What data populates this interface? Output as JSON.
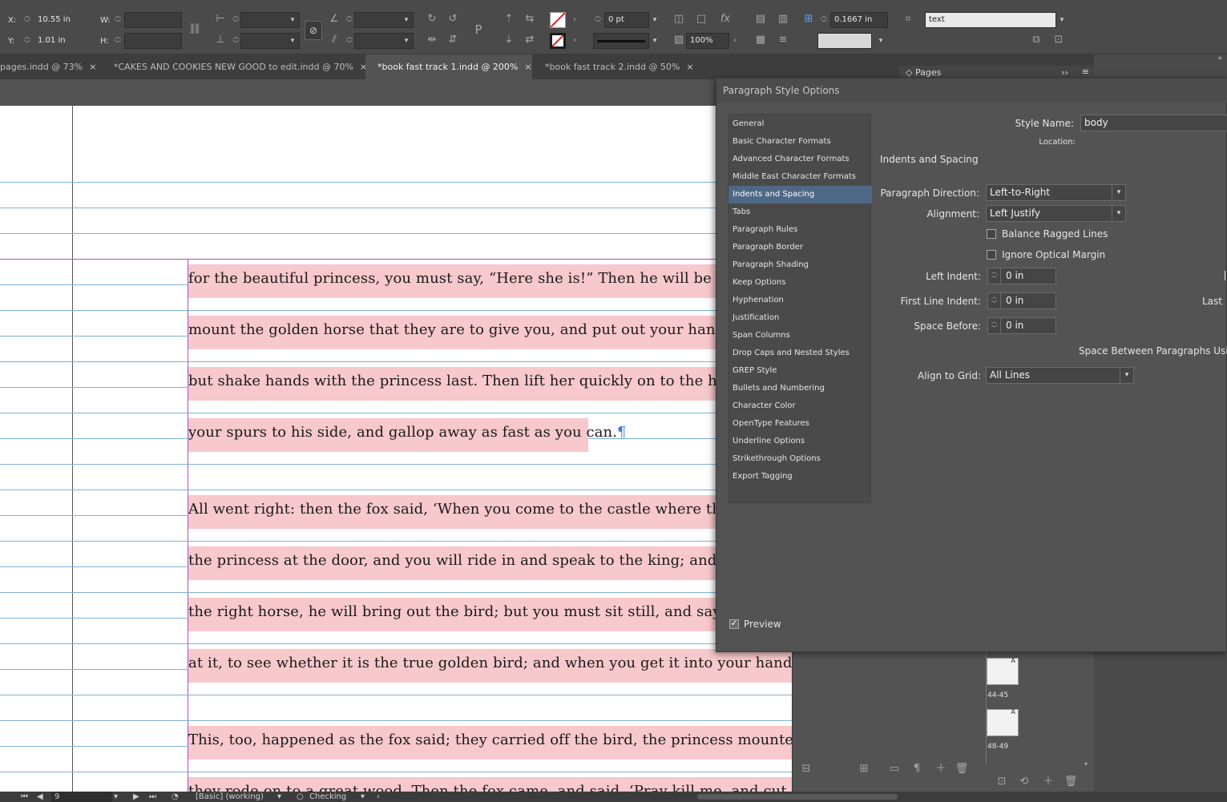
{
  "control_bar": {
    "x_label": "X:",
    "x_value": "10.55 in",
    "y_label": "Y:",
    "y_value": "1.01 in",
    "w_label": "W:",
    "h_label": "H:",
    "stroke_weight": "0 pt",
    "opacity": "100%",
    "column_gap": "0.1667 in",
    "object_style": "text"
  },
  "tabs": [
    {
      "label": "pages.indd @ 73%",
      "active": false
    },
    {
      "label": "*CAKES AND COOKIES NEW GOOD to edit.indd @ 70%",
      "active": false
    },
    {
      "label": "*book fast track 1.indd @ 200%",
      "active": true
    },
    {
      "label": "*book fast track 2.indd @ 50%",
      "active": false
    }
  ],
  "tab_close": "×",
  "document": {
    "lines": [
      "for the beautiful princess, you must say, “Here she is!” Then he will be very jo",
      "mount the golden horse that they are to give you, and put out your hand to t",
      "but shake hands with the princess last. Then lift her quickly on to the horse",
      "your spurs to his side, and gallop away as fast as you can.",
      "All went right: then the fox said, ‘When you come to the castle where the bird",
      "the princess at the door, and you will ride in and speak to the king; and whe",
      "the right horse, he will bring out the bird; but you must sit still, and say that",
      "at it, to see whether it is the true golden bird; and when you get it into your hand, ride a",
      "This, too, happened as the fox said; they carried off the bird, the princess mounted aga",
      "they rode on to a great wood. Then the fox came, and said, ‘Pray kill me, and cut off my head"
    ],
    "pilcrow": "¶"
  },
  "pages_panel": {
    "tab_label": "Pages",
    "spread_labels": [
      "44-45",
      "48-49"
    ],
    "master_letter": "A"
  },
  "dialog": {
    "title": "Paragraph Style Options",
    "categories": [
      "General",
      "Basic Character Formats",
      "Advanced Character Formats",
      "Middle East Character Formats",
      "Indents and Spacing",
      "Tabs",
      "Paragraph Rules",
      "Paragraph Border",
      "Paragraph Shading",
      "Keep Options",
      "Hyphenation",
      "Justification",
      "Span Columns",
      "Drop Caps and Nested Styles",
      "GREP Style",
      "Bullets and Numbering",
      "Character Color",
      "OpenType Features",
      "Underline Options",
      "Strikethrough Options",
      "Export Tagging"
    ],
    "selected_category_index": 4,
    "style_name_label": "Style Name:",
    "style_name_value": "body",
    "location_label": "Location:",
    "section_title": "Indents and Spacing",
    "paragraph_direction_label": "Paragraph Direction:",
    "paragraph_direction_value": "Left-to-Right",
    "alignment_label": "Alignment:",
    "alignment_value": "Left Justify",
    "balance_ragged_label": "Balance Ragged Lines",
    "balance_ragged_checked": false,
    "ignore_optical_label": "Ignore Optical Margin",
    "ignore_optical_checked": false,
    "left_indent_label": "Left Indent:",
    "left_indent_value": "0 in",
    "first_line_indent_label": "First Line Indent:",
    "first_line_indent_value": "0 in",
    "last_line_label_partial": "Last",
    "space_before_label": "Space Before:",
    "space_before_value": "0 in",
    "space_between_label": "Space Between Paragraphs Using",
    "align_to_grid_label": "Align to Grid:",
    "align_to_grid_value": "All Lines",
    "preview_label": "Preview",
    "preview_checked": true
  },
  "status_bar": {
    "page_number": "9",
    "master_state": "[Basic] (working)",
    "preflight": "Checking"
  },
  "colors": {
    "highlight": "#f7c8cc",
    "baseline_grid": "#7fb0d8",
    "selected_category": "#4f6887",
    "frame_edge": "#a54fd0"
  }
}
